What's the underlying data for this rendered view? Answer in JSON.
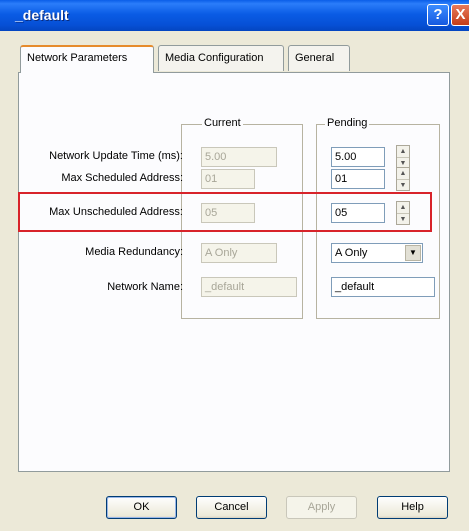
{
  "window": {
    "title": "_default",
    "help_glyph": "?",
    "close_glyph": "X"
  },
  "tabs": [
    {
      "label": "Network Parameters"
    },
    {
      "label": "Media Configuration"
    },
    {
      "label": "General"
    }
  ],
  "groups": {
    "current": "Current",
    "pending": "Pending"
  },
  "rows": [
    {
      "label": "Network Update Time (ms):",
      "current": "5.00",
      "pending": "5.00"
    },
    {
      "label": "Max Scheduled Address:",
      "current": "01",
      "pending": "01"
    },
    {
      "label": "Max Unscheduled Address:",
      "current": "05",
      "pending": "05"
    },
    {
      "label": "Media Redundancy:",
      "current": "A Only",
      "pending": "A Only"
    },
    {
      "label": "Network Name:",
      "current": "_default",
      "pending": "_default"
    }
  ],
  "buttons": {
    "ok": "OK",
    "cancel": "Cancel",
    "apply": "Apply",
    "help": "Help"
  },
  "highlight_color": "#d8232a"
}
